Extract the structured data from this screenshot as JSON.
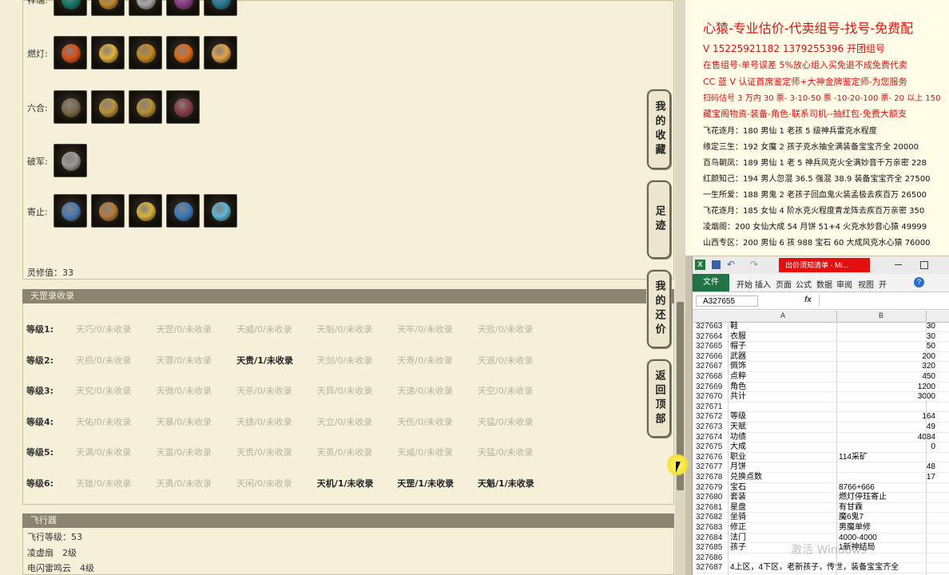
{
  "game": {
    "rows": [
      {
        "label": "祥瑞:",
        "icons": [
          "pet-icon",
          "ornament-icon",
          "bead-icon",
          "squid-icon",
          "mask-icon"
        ]
      },
      {
        "label": "燃灯:",
        "icons": [
          "flame-icon",
          "robe-icon",
          "bell-icon",
          "lantern-icon",
          "cake-icon"
        ]
      },
      {
        "label": "六合:",
        "icons": [
          "necklace-icon",
          "ring-icon",
          "ring-icon",
          "bracelet-icon"
        ]
      },
      {
        "label": "破军:",
        "icons": [
          "armlet-icon"
        ]
      },
      {
        "label": "寄止:",
        "icons": [
          "spirit-icon",
          "staff-icon",
          "ingot-icon",
          "crystal-icon",
          "wing-icon"
        ]
      }
    ],
    "spirit_value": "灵修值：33",
    "collection": {
      "title": "天罡录收录",
      "levels": [
        {
          "label": "等级1:",
          "items": [
            {
              "t": "天巧/0/未收录",
              "got": false
            },
            {
              "t": "天罡/0/未收录",
              "got": false
            },
            {
              "t": "天威/0/未收录",
              "got": false
            },
            {
              "t": "天魁/0/未收录",
              "got": false
            },
            {
              "t": "天牢/0/未收录",
              "got": false
            },
            {
              "t": "天败/0/未收录",
              "got": false
            }
          ]
        },
        {
          "label": "等级2:",
          "items": [
            {
              "t": "天损/0/未收录",
              "got": false
            },
            {
              "t": "天罪/0/未收录",
              "got": false
            },
            {
              "t": "天贵/1/未收录",
              "got": true
            },
            {
              "t": "天剑/0/未收录",
              "got": false
            },
            {
              "t": "天寿/0/未收录",
              "got": false
            },
            {
              "t": "天退/0/未收录",
              "got": false
            }
          ]
        },
        {
          "label": "等级3:",
          "items": [
            {
              "t": "天究/0/未收录",
              "got": false
            },
            {
              "t": "天微/0/未收录",
              "got": false
            },
            {
              "t": "天杀/0/未收录",
              "got": false
            },
            {
              "t": "天异/0/未收录",
              "got": false
            },
            {
              "t": "天速/0/未收录",
              "got": false
            },
            {
              "t": "天空/0/未收录",
              "got": false
            }
          ]
        },
        {
          "label": "等级4:",
          "items": [
            {
              "t": "天佑/0/未收录",
              "got": false
            },
            {
              "t": "天暴/0/未收录",
              "got": false
            },
            {
              "t": "天捷/0/未收录",
              "got": false
            },
            {
              "t": "天立/0/未收录",
              "got": false
            },
            {
              "t": "天伤/0/未收录",
              "got": false
            },
            {
              "t": "天猛/0/未收录",
              "got": false
            }
          ]
        },
        {
          "label": "等级5:",
          "items": [
            {
              "t": "天满/0/未收录",
              "got": false
            },
            {
              "t": "天富/0/未收录",
              "got": false
            },
            {
              "t": "天贵/0/未收录",
              "got": false
            },
            {
              "t": "天英/0/未收录",
              "got": false
            },
            {
              "t": "天威/0/未收录",
              "got": false
            },
            {
              "t": "天猛/0/未收录",
              "got": false
            }
          ]
        },
        {
          "label": "等级6:",
          "items": [
            {
              "t": "天雄/0/未收录",
              "got": false
            },
            {
              "t": "天勇/0/未收录",
              "got": false
            },
            {
              "t": "天闲/0/未收录",
              "got": false
            },
            {
              "t": "天机/1/未收录",
              "got": true
            },
            {
              "t": "天罡/1/未收录",
              "got": true
            },
            {
              "t": "天魁/1/未收录",
              "got": true
            }
          ]
        }
      ]
    },
    "flyer": {
      "title": "飞行器",
      "level": "飞行等级：53",
      "items": [
        "凌虚扇　2级",
        "电闪雷鸣云　4级"
      ]
    },
    "side_buttons": [
      "我的收藏",
      "足迹",
      "我的还价",
      "返回顶部"
    ]
  },
  "ad": {
    "title": "心猿-专业估价-代卖组号-找号-免费配",
    "lines": [
      {
        "t": "V 15225921182   1379255396 开团组号",
        "c": "#d81010",
        "s": 12
      },
      {
        "t": "在售组号-单号误差 5%放心组入买免退不成免费代卖",
        "c": "#d81010",
        "s": 11
      },
      {
        "t": "CC 蓝 V 认证首席鉴定师+大神金牌鉴定师-为您服务",
        "c": "#d81010",
        "s": 11
      },
      {
        "t": "扫码估号 3 万内 30 票- 3-10-50 票  -10-20-100 票- 20 以上 150",
        "c": "#d81010",
        "s": 10
      },
      {
        "t": "藏宝阁物资-装备-角色-联系司机--抽红包-免费大额支",
        "c": "#d81010",
        "s": 11
      },
      {
        "t": "飞花逐月：180 男仙 1 老孩 5 级神兵雷克水程度",
        "c": "#111",
        "s": 10
      },
      {
        "t": "缘定三生：192 女魔 2 孩子克水抽全满装备宝宝齐全 20000",
        "c": "#111",
        "s": 10
      },
      {
        "t": "百鸟朝凤：189 男仙 1 老 5 神兵风克火全满妙音千万亲密 228",
        "c": "#111",
        "s": 10
      },
      {
        "t": "红颜知己：194 男人忽混 36.5 强混 38.9 装备宝宝齐全 27500",
        "c": "#111",
        "s": 10
      },
      {
        "t": "一生所爱：188 男鬼 2 老孩子回血鬼火装孟极去疾百万 26500",
        "c": "#111",
        "s": 10
      },
      {
        "t": "飞花逐月：185 女仙 4 阶水克火程度青龙阵去疾百万亲密 350",
        "c": "#111",
        "s": 10
      },
      {
        "t": "凌烟阁：200 女仙大成 54 月饼 51+4 火克水妙音心猿 49999",
        "c": "#111",
        "s": 10
      },
      {
        "t": "山西专区：200 男仙 6 孩 988 宝石 60 大成风克水心猿 76000",
        "c": "#111",
        "s": 10
      }
    ]
  },
  "excel": {
    "title": "出价须知清单 - Mi...",
    "tabs": [
      "文件",
      "开始",
      "插入",
      "页面",
      "公式",
      "数据",
      "审阅",
      "视图",
      "开"
    ],
    "name_box": "A327655",
    "fx": "fx",
    "col_a": "A",
    "col_b": "B",
    "rows": [
      {
        "n": "327663",
        "a": "鞋",
        "b": "30",
        "num": true
      },
      {
        "n": "327664",
        "a": "衣服",
        "b": "30",
        "num": true
      },
      {
        "n": "327665",
        "a": "帽子",
        "b": "50",
        "num": true
      },
      {
        "n": "327666",
        "a": "武器",
        "b": "200",
        "num": true
      },
      {
        "n": "327667",
        "a": "佩饰",
        "b": "320",
        "num": true
      },
      {
        "n": "327668",
        "a": "点粹",
        "b": "450",
        "num": true
      },
      {
        "n": "327669",
        "a": "角色",
        "b": "1200",
        "num": true
      },
      {
        "n": "327670",
        "a": "共计",
        "b": "3000",
        "num": true
      },
      {
        "n": "327671",
        "a": "",
        "b": "",
        "num": true
      },
      {
        "n": "327672",
        "a": "等级",
        "b": "164",
        "num": true
      },
      {
        "n": "327673",
        "a": "天赋",
        "b": "49",
        "num": true
      },
      {
        "n": "327674",
        "a": "功绩",
        "b": "4084",
        "num": true
      },
      {
        "n": "327675",
        "a": "大成",
        "b": "0",
        "num": true
      },
      {
        "n": "327676",
        "a": "职业",
        "b": "114采矿",
        "num": false
      },
      {
        "n": "327677",
        "a": "月饼",
        "b": "48",
        "num": true
      },
      {
        "n": "327678",
        "a": "兑换点数",
        "b": "17",
        "num": true
      },
      {
        "n": "327679",
        "a": "宝石",
        "b": "8766+666",
        "num": false
      },
      {
        "n": "327680",
        "a": "套装",
        "b": "燃灯停珏寄止",
        "num": false
      },
      {
        "n": "327681",
        "a": "星盘",
        "b": "有甘霖",
        "num": false
      },
      {
        "n": "327682",
        "a": "坐骑",
        "b": "魔6鬼7",
        "num": false
      },
      {
        "n": "327683",
        "a": "修正",
        "b": "男魔单修",
        "num": false
      },
      {
        "n": "327684",
        "a": "法门",
        "b": "4000-4000",
        "num": false
      },
      {
        "n": "327685",
        "a": "孩子",
        "b": "1新神结局",
        "num": false
      },
      {
        "n": "327686",
        "a": "",
        "b": "",
        "num": false
      },
      {
        "n": "327687",
        "a": "4上区，4下区，老新孩子，传世，装备宝宝齐全",
        "b": "",
        "num": false
      }
    ]
  },
  "watermark": "激活 Windows"
}
